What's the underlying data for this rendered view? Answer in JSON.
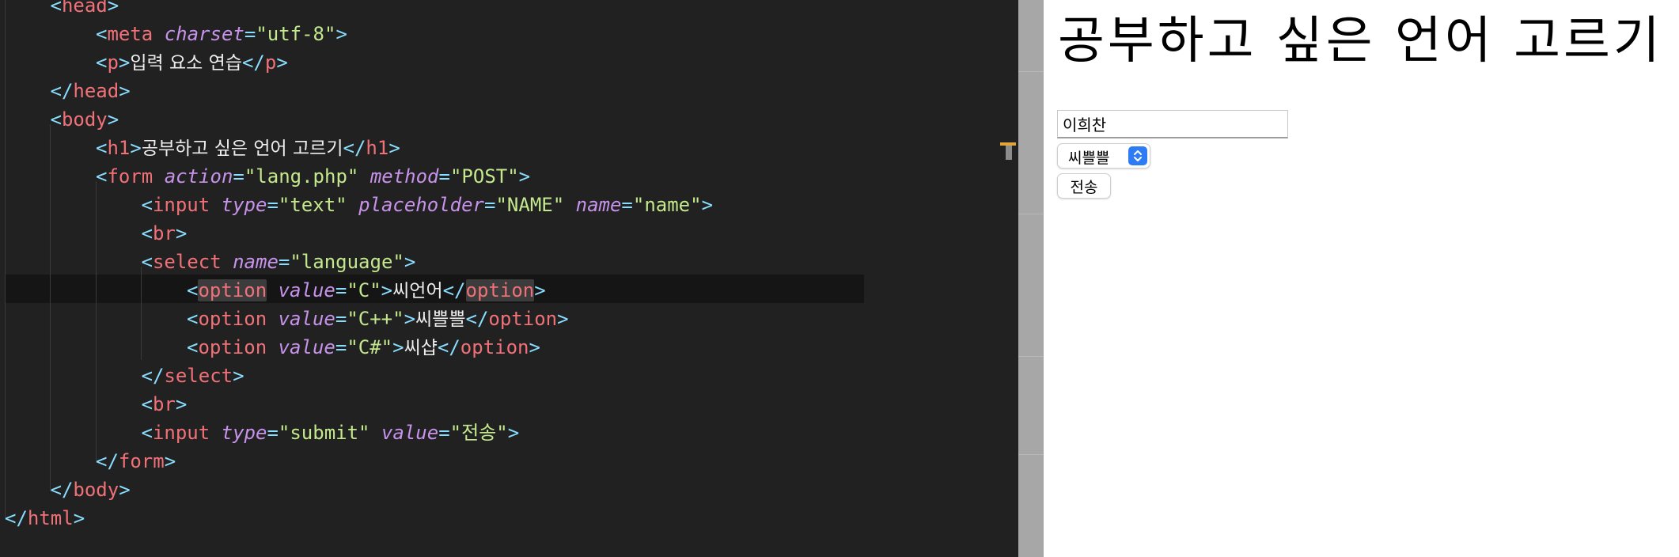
{
  "editor": {
    "lines": [
      {
        "indent": 1,
        "parts": [
          [
            "p",
            "<"
          ],
          [
            "t",
            "head"
          ],
          [
            "p",
            ">"
          ]
        ]
      },
      {
        "indent": 2,
        "parts": [
          [
            "p",
            "<"
          ],
          [
            "t",
            "meta"
          ],
          [
            "x",
            " "
          ],
          [
            "a",
            "charset"
          ],
          [
            "p",
            "="
          ],
          [
            "s",
            "\"utf-8\""
          ],
          [
            "p",
            ">"
          ]
        ]
      },
      {
        "indent": 2,
        "parts": [
          [
            "p",
            "<"
          ],
          [
            "t",
            "p"
          ],
          [
            "p",
            ">"
          ],
          [
            "k",
            "입력 요소 연습"
          ],
          [
            "p",
            "</"
          ],
          [
            "t",
            "p"
          ],
          [
            "p",
            ">"
          ]
        ]
      },
      {
        "indent": 1,
        "parts": [
          [
            "p",
            "</"
          ],
          [
            "t",
            "head"
          ],
          [
            "p",
            ">"
          ]
        ]
      },
      {
        "indent": 1,
        "parts": [
          [
            "p",
            "<"
          ],
          [
            "t",
            "body"
          ],
          [
            "p",
            ">"
          ]
        ]
      },
      {
        "indent": 2,
        "parts": [
          [
            "p",
            "<"
          ],
          [
            "t",
            "h1"
          ],
          [
            "p",
            ">"
          ],
          [
            "k",
            "공부하고 싶은 언어 고르기"
          ],
          [
            "p",
            "</"
          ],
          [
            "t",
            "h1"
          ],
          [
            "p",
            ">"
          ]
        ]
      },
      {
        "indent": 2,
        "parts": [
          [
            "p",
            "<"
          ],
          [
            "t",
            "form"
          ],
          [
            "x",
            " "
          ],
          [
            "a",
            "action"
          ],
          [
            "p",
            "="
          ],
          [
            "s",
            "\"lang.php\""
          ],
          [
            "x",
            " "
          ],
          [
            "a",
            "method"
          ],
          [
            "p",
            "="
          ],
          [
            "s",
            "\"POST\""
          ],
          [
            "p",
            ">"
          ]
        ]
      },
      {
        "indent": 3,
        "parts": [
          [
            "p",
            "<"
          ],
          [
            "t",
            "input"
          ],
          [
            "x",
            " "
          ],
          [
            "a",
            "type"
          ],
          [
            "p",
            "="
          ],
          [
            "s",
            "\"text\""
          ],
          [
            "x",
            " "
          ],
          [
            "a",
            "placeholder"
          ],
          [
            "p",
            "="
          ],
          [
            "s",
            "\"NAME\""
          ],
          [
            "x",
            " "
          ],
          [
            "a",
            "name"
          ],
          [
            "p",
            "="
          ],
          [
            "s",
            "\"name\""
          ],
          [
            "p",
            ">"
          ]
        ]
      },
      {
        "indent": 3,
        "parts": [
          [
            "p",
            "<"
          ],
          [
            "t",
            "br"
          ],
          [
            "p",
            ">"
          ]
        ]
      },
      {
        "indent": 3,
        "parts": [
          [
            "p",
            "<"
          ],
          [
            "t",
            "select"
          ],
          [
            "x",
            " "
          ],
          [
            "a",
            "name"
          ],
          [
            "p",
            "="
          ],
          [
            "s",
            "\"language\""
          ],
          [
            "p",
            ">"
          ]
        ]
      },
      {
        "indent": 4,
        "parts": [
          [
            "p",
            "<"
          ],
          [
            "m",
            "option"
          ],
          [
            "x",
            " "
          ],
          [
            "a",
            "value"
          ],
          [
            "p",
            "="
          ],
          [
            "s",
            "\"C\""
          ],
          [
            "p",
            ">"
          ],
          [
            "k",
            "씨언어"
          ],
          [
            "p",
            "</"
          ],
          [
            "m",
            "option"
          ],
          [
            "p",
            ">"
          ]
        ]
      },
      {
        "indent": 4,
        "parts": [
          [
            "p",
            "<"
          ],
          [
            "t",
            "option"
          ],
          [
            "x",
            " "
          ],
          [
            "a",
            "value"
          ],
          [
            "p",
            "="
          ],
          [
            "s",
            "\"C++\""
          ],
          [
            "p",
            ">"
          ],
          [
            "k",
            "씨쁠쁠"
          ],
          [
            "p",
            "</"
          ],
          [
            "t",
            "option"
          ],
          [
            "p",
            ">"
          ]
        ]
      },
      {
        "indent": 4,
        "parts": [
          [
            "p",
            "<"
          ],
          [
            "t",
            "option"
          ],
          [
            "x",
            " "
          ],
          [
            "a",
            "value"
          ],
          [
            "p",
            "="
          ],
          [
            "s",
            "\"C#\""
          ],
          [
            "p",
            ">"
          ],
          [
            "k",
            "씨샵"
          ],
          [
            "p",
            "</"
          ],
          [
            "t",
            "option"
          ],
          [
            "p",
            ">"
          ]
        ]
      },
      {
        "indent": 3,
        "parts": [
          [
            "p",
            "</"
          ],
          [
            "t",
            "select"
          ],
          [
            "p",
            ">"
          ]
        ]
      },
      {
        "indent": 3,
        "parts": [
          [
            "p",
            "<"
          ],
          [
            "t",
            "br"
          ],
          [
            "p",
            ">"
          ]
        ]
      },
      {
        "indent": 3,
        "parts": [
          [
            "p",
            "<"
          ],
          [
            "t",
            "input"
          ],
          [
            "x",
            " "
          ],
          [
            "a",
            "type"
          ],
          [
            "p",
            "="
          ],
          [
            "s",
            "\"submit\""
          ],
          [
            "x",
            " "
          ],
          [
            "a",
            "value"
          ],
          [
            "p",
            "="
          ],
          [
            "s",
            "\"전송\""
          ],
          [
            "p",
            ">"
          ]
        ]
      },
      {
        "indent": 2,
        "parts": [
          [
            "p",
            "</"
          ],
          [
            "t",
            "form"
          ],
          [
            "p",
            ">"
          ]
        ]
      },
      {
        "indent": 1,
        "parts": [
          [
            "p",
            "</"
          ],
          [
            "t",
            "body"
          ],
          [
            "p",
            ">"
          ]
        ]
      },
      {
        "indent": 0,
        "parts": [
          [
            "p",
            "</"
          ],
          [
            "t",
            "html"
          ],
          [
            "p",
            ">"
          ]
        ]
      }
    ]
  },
  "preview": {
    "title": "공부하고 싶은 언어 고르기",
    "name_value": "이희찬",
    "name_placeholder": "NAME",
    "select_selected": "씨쁠쁠",
    "submit_label": "전송"
  },
  "colors": {
    "tag": "#f07178",
    "punctuation": "#89ddff",
    "attribute": "#c792ea",
    "string": "#c3e88d",
    "editor_bg": "#212121",
    "select_arrow": "#2d7cf6"
  }
}
